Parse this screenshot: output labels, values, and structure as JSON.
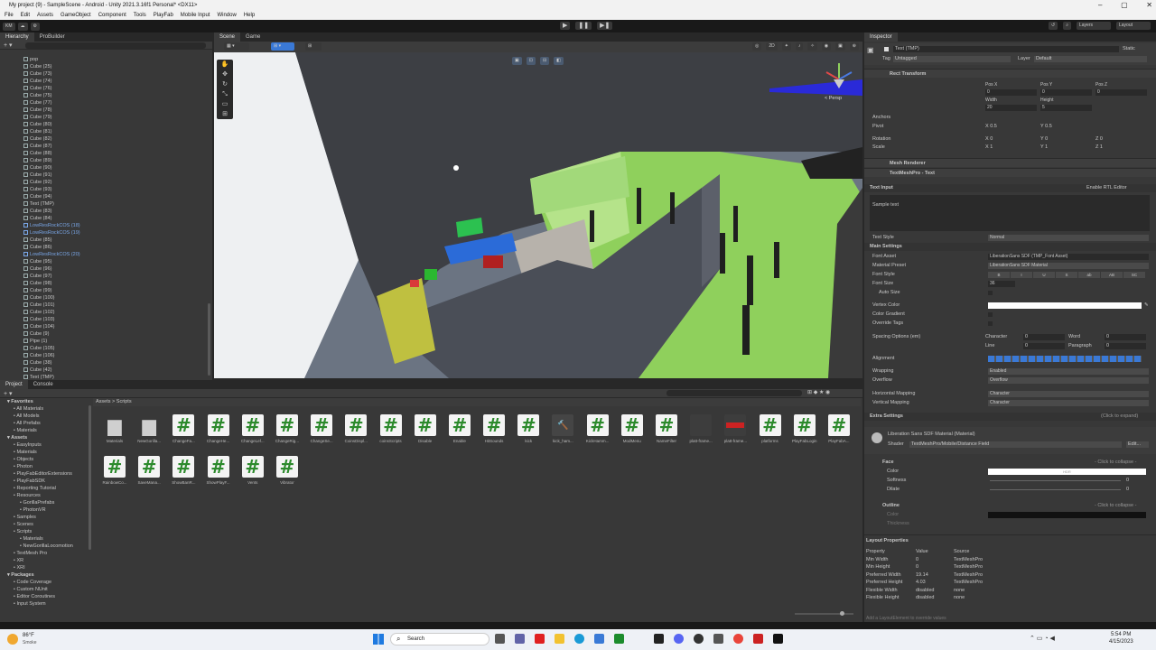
{
  "title": "My project (9) - SampleScene - Android - Unity 2021.3.16f1 Personal* <DX11>",
  "menu": [
    "File",
    "Edit",
    "Assets",
    "GameObject",
    "Component",
    "Tools",
    "PlayFab",
    "Mobile Input",
    "Window",
    "Help"
  ],
  "toolbar": {
    "account": "KM",
    "layers": "Layers",
    "layout": "Layout"
  },
  "hierarchy": {
    "tabs": [
      "Hierarchy",
      "ProBuilder"
    ],
    "items": [
      {
        "name": "pop",
        "blue": false
      },
      {
        "name": "Cube (25)",
        "blue": false
      },
      {
        "name": "Cube (73)",
        "blue": false
      },
      {
        "name": "Cube (74)",
        "blue": false
      },
      {
        "name": "Cube (76)",
        "blue": false
      },
      {
        "name": "Cube (75)",
        "blue": false
      },
      {
        "name": "Cube (77)",
        "blue": false
      },
      {
        "name": "Cube (78)",
        "blue": false
      },
      {
        "name": "Cube (79)",
        "blue": false
      },
      {
        "name": "Cube (80)",
        "blue": false
      },
      {
        "name": "Cube (81)",
        "blue": false
      },
      {
        "name": "Cube (82)",
        "blue": false
      },
      {
        "name": "Cube (87)",
        "blue": false
      },
      {
        "name": "Cube (88)",
        "blue": false
      },
      {
        "name": "Cube (89)",
        "blue": false
      },
      {
        "name": "Cube (90)",
        "blue": false
      },
      {
        "name": "Cube (91)",
        "blue": false
      },
      {
        "name": "Cube (92)",
        "blue": false
      },
      {
        "name": "Cube (93)",
        "blue": false
      },
      {
        "name": "Cube (94)",
        "blue": false
      },
      {
        "name": "Text (TMP)",
        "blue": false
      },
      {
        "name": "Cube (83)",
        "blue": false
      },
      {
        "name": "Cube (84)",
        "blue": false
      },
      {
        "name": "LowResRockCOS (18)",
        "blue": true
      },
      {
        "name": "LowResRockCOS (19)",
        "blue": true
      },
      {
        "name": "Cube (85)",
        "blue": false
      },
      {
        "name": "Cube (86)",
        "blue": false
      },
      {
        "name": "LowResRockCOS (20)",
        "blue": true
      },
      {
        "name": "Cube (95)",
        "blue": false
      },
      {
        "name": "Cube (96)",
        "blue": false
      },
      {
        "name": "Cube (97)",
        "blue": false
      },
      {
        "name": "Cube (98)",
        "blue": false
      },
      {
        "name": "Cube (99)",
        "blue": false
      },
      {
        "name": "Cube (100)",
        "blue": false
      },
      {
        "name": "Cube (101)",
        "blue": false
      },
      {
        "name": "Cube (102)",
        "blue": false
      },
      {
        "name": "Cube (103)",
        "blue": false
      },
      {
        "name": "Cube (104)",
        "blue": false
      },
      {
        "name": "Cube (9)",
        "blue": false
      },
      {
        "name": "Pipe (1)",
        "blue": false
      },
      {
        "name": "Cube (105)",
        "blue": false
      },
      {
        "name": "Cube (106)",
        "blue": false
      },
      {
        "name": "Cube (38)",
        "blue": false
      },
      {
        "name": "Cube (42)",
        "blue": false
      },
      {
        "name": "Text (TMP)",
        "blue": false
      }
    ]
  },
  "scene": {
    "tabs": [
      "Scene",
      "Game"
    ],
    "persp": "< Persp"
  },
  "project": {
    "tabs": [
      "Project",
      "Console"
    ],
    "breadcrumb": "Assets > Scripts",
    "tree": [
      {
        "label": "Favorites",
        "bold": true,
        "indent": 0
      },
      {
        "label": "All Materials",
        "bold": false,
        "indent": 1
      },
      {
        "label": "All Models",
        "bold": false,
        "indent": 1
      },
      {
        "label": "All Prefabs",
        "bold": false,
        "indent": 1
      },
      {
        "label": "Materials",
        "bold": false,
        "indent": 1
      },
      {
        "label": "Assets",
        "bold": true,
        "indent": 0
      },
      {
        "label": "EasyInputs",
        "bold": false,
        "indent": 1
      },
      {
        "label": "Materials",
        "bold": false,
        "indent": 1
      },
      {
        "label": "Objects",
        "bold": false,
        "indent": 1
      },
      {
        "label": "Photon",
        "bold": false,
        "indent": 1
      },
      {
        "label": "PlayFabEditorExtensions",
        "bold": false,
        "indent": 1
      },
      {
        "label": "PlayFabSDK",
        "bold": false,
        "indent": 1
      },
      {
        "label": "Reporting Tutorial",
        "bold": false,
        "indent": 1
      },
      {
        "label": "Resources",
        "bold": false,
        "indent": 1
      },
      {
        "label": "GorillaPrefabs",
        "bold": false,
        "indent": 2
      },
      {
        "label": "PhotonVR",
        "bold": false,
        "indent": 2
      },
      {
        "label": "Samples",
        "bold": false,
        "indent": 1
      },
      {
        "label": "Scenes",
        "bold": false,
        "indent": 1
      },
      {
        "label": "Scripts",
        "bold": false,
        "indent": 1
      },
      {
        "label": "Materials",
        "bold": false,
        "indent": 2
      },
      {
        "label": "NewGorillaLocomotion",
        "bold": false,
        "indent": 2
      },
      {
        "label": "TextMesh Pro",
        "bold": false,
        "indent": 1
      },
      {
        "label": "XR",
        "bold": false,
        "indent": 1
      },
      {
        "label": "XRI",
        "bold": false,
        "indent": 1
      },
      {
        "label": "Packages",
        "bold": true,
        "indent": 0
      },
      {
        "label": "Code Coverage",
        "bold": false,
        "indent": 1
      },
      {
        "label": "Custom NUnit",
        "bold": false,
        "indent": 1
      },
      {
        "label": "Editor Coroutines",
        "bold": false,
        "indent": 1
      },
      {
        "label": "Input System",
        "bold": false,
        "indent": 1
      }
    ],
    "assets_row1": [
      {
        "name": "Materials",
        "kind": "folder"
      },
      {
        "name": "NewGorilla...",
        "kind": "folder"
      },
      {
        "name": "ChangeFa...",
        "kind": "script"
      },
      {
        "name": "ChangeHe...",
        "kind": "script"
      },
      {
        "name": "ChangeLef...",
        "kind": "script"
      },
      {
        "name": "ChangeRig...",
        "kind": "script"
      },
      {
        "name": "ChangeSe...",
        "kind": "script"
      },
      {
        "name": "CoinsDispl...",
        "kind": "script"
      },
      {
        "name": "coinsScripts",
        "kind": "script"
      },
      {
        "name": "Disable",
        "kind": "script"
      },
      {
        "name": "Enable",
        "kind": "script"
      },
      {
        "name": "HitSounds",
        "kind": "script"
      },
      {
        "name": "kick",
        "kind": "script"
      },
      {
        "name": "kick_ham...",
        "kind": "grey"
      },
      {
        "name": "KickHamm...",
        "kind": "script"
      },
      {
        "name": "ModMenu",
        "kind": "script"
      },
      {
        "name": "NameFilter",
        "kind": "script"
      },
      {
        "name": "platt-frame...",
        "kind": "dark"
      },
      {
        "name": "platt-frame...",
        "kind": "red"
      },
      {
        "name": "platforms",
        "kind": "script"
      },
      {
        "name": "PlayFabLogin",
        "kind": "script"
      },
      {
        "name": "PlayFabA...",
        "kind": "script"
      }
    ],
    "assets_row2": [
      {
        "name": "RainbowCo...",
        "kind": "script"
      },
      {
        "name": "SaveMana...",
        "kind": "script"
      },
      {
        "name": "ShowBanR...",
        "kind": "script"
      },
      {
        "name": "ShowPlayF...",
        "kind": "script"
      },
      {
        "name": "Vents",
        "kind": "script"
      },
      {
        "name": "Vibrator",
        "kind": "script"
      }
    ]
  },
  "inspector": {
    "tab": "Inspector",
    "object_name": "Text (TMP)",
    "static": "Static",
    "tag_label": "Tag",
    "tag_value": "Untagged",
    "layer_label": "Layer",
    "layer_value": "Default",
    "rect_transform": "Rect Transform",
    "pos_labels": [
      "Pos X",
      "Pos Y",
      "Pos Z"
    ],
    "pos_values": [
      "0",
      "0",
      "0"
    ],
    "size_labels": [
      "Width",
      "Height"
    ],
    "size_values": [
      "20",
      "5"
    ],
    "anchors": "Anchors",
    "pivot_label": "Pivot",
    "pivot_x": "0.5",
    "pivot_y": "0.5",
    "rotation_label": "Rotation",
    "rotation": [
      "0",
      "0",
      "0"
    ],
    "scale_label": "Scale",
    "scale": [
      "1",
      "1",
      "1"
    ],
    "mesh_renderer": "Mesh Renderer",
    "textmeshpro": "TextMeshPro - Text",
    "text_input": "Text Input",
    "enable_rtl": "Enable RTL Editor",
    "sample_text": "Sample text",
    "text_style_label": "Text Style",
    "text_style_value": "Normal",
    "main_settings": "Main Settings",
    "font_asset_label": "Font Asset",
    "font_asset_value": "LiberationSans SDF (TMP_Font Asset)",
    "material_preset_label": "Material Preset",
    "material_preset_value": "LiberationSans SDF Material",
    "font_style_label": "Font Style",
    "font_style_buttons": [
      "B",
      "I",
      "U",
      "S",
      "ab",
      "AB",
      "SC"
    ],
    "font_size_label": "Font Size",
    "font_size_value": "36",
    "auto_size": "Auto Size",
    "vertex_color": "Vertex Color",
    "color_gradient": "Color Gradient",
    "override_tags": "Override Tags",
    "spacing_label": "Spacing Options (em)",
    "character_label": "Character",
    "character_value": "0",
    "word_label": "Word",
    "word_value": "0",
    "line_label": "Line",
    "line_value": "0",
    "paragraph_label": "Paragraph",
    "paragraph_value": "0",
    "alignment": "Alignment",
    "wrapping_label": "Wrapping",
    "wrapping_value": "Enabled",
    "overflow_label": "Overflow",
    "overflow_value": "Overflow",
    "hmap_label": "Horizontal Mapping",
    "hmap_value": "Character",
    "vmap_label": "Vertical Mapping",
    "vmap_value": "Character",
    "extra_settings": "Extra Settings",
    "click_expand": "(Click to expand)",
    "material_name": "Liberation Sans SDF Material (Material)",
    "shader_label": "Shader",
    "shader_value": "TextMeshPro/Mobile/Distance Field",
    "edit": "Edit...",
    "face": "Face",
    "click_collapse": "- Click to collapse -",
    "color_label": "Color",
    "hdr": "HDR",
    "softness_label": "Softness",
    "softness_value": "0",
    "dilate_label": "Dilate",
    "dilate_value": "0",
    "outline": "Outline",
    "outline_color": "Color",
    "thickness": "Thickness",
    "layout_properties": "Layout Properties",
    "layout_headers": [
      "Property",
      "Value",
      "Source"
    ],
    "layout_rows": [
      [
        "Min Width",
        "0",
        "TextMeshPro"
      ],
      [
        "Min Height",
        "0",
        "TextMeshPro"
      ],
      [
        "Preferred Width",
        "19.14",
        "TextMeshPro"
      ],
      [
        "Preferred Height",
        "4.03",
        "TextMeshPro"
      ],
      [
        "Flexible Width",
        "disabled",
        "none"
      ],
      [
        "Flexible Height",
        "disabled",
        "none"
      ]
    ],
    "add_layout": "Add a LayoutElement to override values"
  },
  "taskbar": {
    "temp": "86°F",
    "weather": "Smoke",
    "search": "Search",
    "time": "5:54 PM",
    "date": "4/15/2023"
  },
  "colors": {
    "accent": "#3a79d6",
    "hier_blue": "#7aa7e8",
    "script_green": "#2c8a2c",
    "scene_green": "#8fd05c"
  }
}
